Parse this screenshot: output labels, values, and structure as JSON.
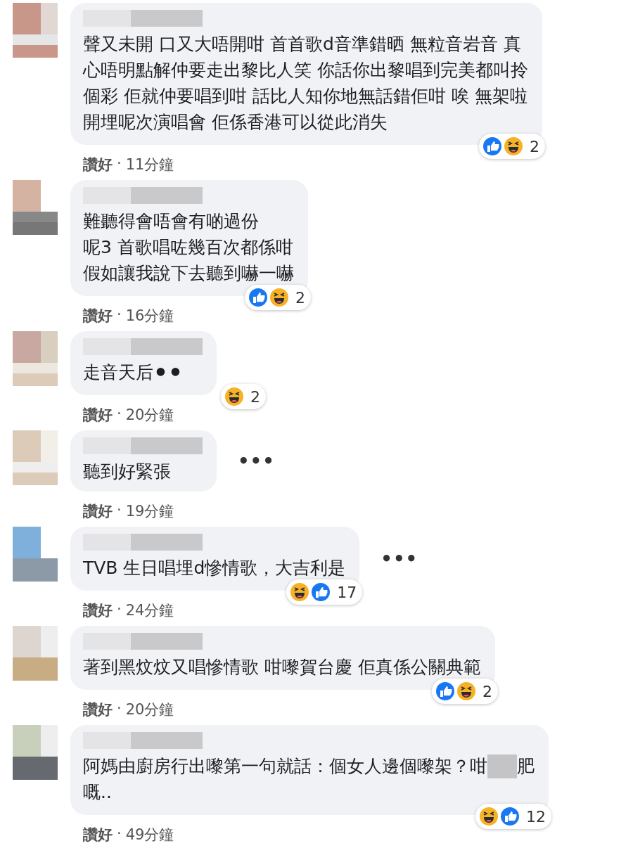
{
  "comments": [
    {
      "lines": [
        {
          "text": "聲又未開 口又大唔開咁 首首歌d音準錯晒 無粒音岩音 真"
        },
        {
          "text": "心唔明點解仲要走出黎比人笑 你話你出黎唱到完美都叫拎"
        },
        {
          "text": "個彩 佢就仲要唱到咁 話比人知你地無話錯佢咁 唉 無架啦"
        },
        {
          "text": "開埋呢次演唱會 佢係香港可以從此消失"
        }
      ],
      "reactions": [
        {
          "kind": "like"
        },
        {
          "kind": "haha"
        }
      ],
      "count": "2",
      "like_label": "讚好",
      "separator": "·",
      "time": "11分鐘"
    },
    {
      "lines": [
        {
          "text": "難聽得會唔會有啲過份"
        },
        {
          "text": "呢3 首歌唱咗幾百次都係咁"
        },
        {
          "text": "假如讓我說下去聽到嚇一嚇"
        }
      ],
      "reactions": [
        {
          "kind": "like"
        },
        {
          "kind": "haha"
        }
      ],
      "count": "2",
      "like_label": "讚好",
      "separator": "·",
      "time": "16分鐘"
    },
    {
      "lines": [
        {
          "text": "走音天后⚫⚫"
        }
      ],
      "reactions": [
        {
          "kind": "haha"
        }
      ],
      "count": "2",
      "like_label": "讚好",
      "separator": "·",
      "time": "20分鐘"
    },
    {
      "lines": [
        {
          "text": "聽到好緊張"
        }
      ],
      "like_label": "讚好",
      "separator": "·",
      "time": "19分鐘",
      "more_label": "•••"
    },
    {
      "lines": [
        {
          "text": "TVB 生日唱埋d慘情歌，大吉利是"
        }
      ],
      "reactions": [
        {
          "kind": "haha"
        },
        {
          "kind": "like"
        }
      ],
      "count": "17",
      "like_label": "讚好",
      "separator": "·",
      "time": "24分鐘",
      "more_label": "•••"
    },
    {
      "lines": [
        {
          "text": "著到黑炆炆又唱慘情歌 咁嚟賀台慶 佢真係公關典範"
        }
      ],
      "reactions": [
        {
          "kind": "like"
        },
        {
          "kind": "haha"
        }
      ],
      "count": "2",
      "like_label": "讚好",
      "separator": "·",
      "time": "20分鐘"
    },
    {
      "lines": [
        {
          "text": "阿媽由廚房行出嚟第一句就話：個女人邊個嚟架？咁",
          "redacted": true,
          "text_after": "肥"
        },
        {
          "text": "嘅.."
        }
      ],
      "reactions": [
        {
          "kind": "haha"
        },
        {
          "kind": "like"
        }
      ],
      "count": "12",
      "like_label": "讚好",
      "separator": "·",
      "time": "49分鐘"
    }
  ]
}
